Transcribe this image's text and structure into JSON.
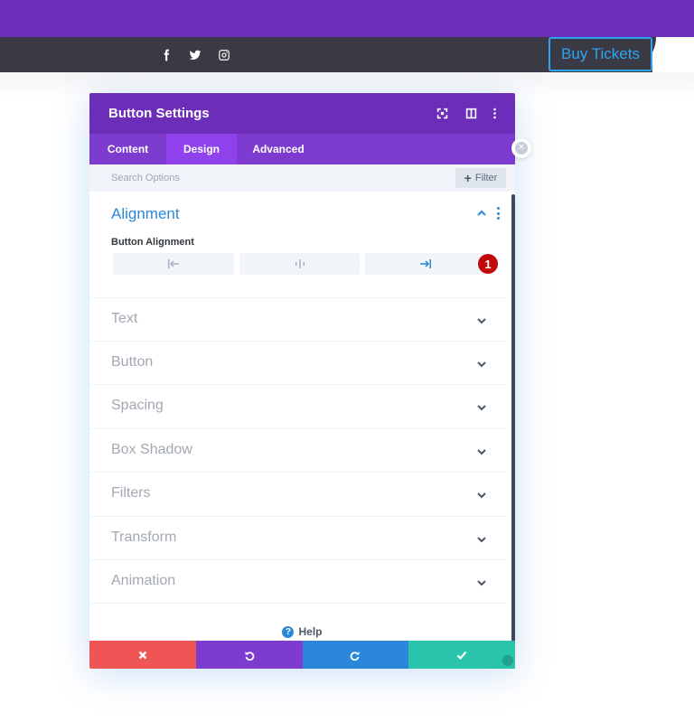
{
  "site": {
    "social_icons": [
      "facebook-icon",
      "twitter-icon",
      "instagram-icon"
    ],
    "buy_button": "Buy Tickets",
    "colors": {
      "topbar": "#6c2eb9",
      "darkbar": "#3a3a44",
      "accent": "#2ea3f2"
    }
  },
  "modal": {
    "title": "Button Settings",
    "header_icons": [
      "expand-icon",
      "split-view-icon",
      "more-options-icon"
    ],
    "tabs": [
      {
        "label": "Content",
        "active": false
      },
      {
        "label": "Design",
        "active": true
      },
      {
        "label": "Advanced",
        "active": false
      }
    ],
    "search": {
      "placeholder": "Search Options",
      "filter_label": "Filter"
    },
    "alignment": {
      "title": "Alignment",
      "field_label": "Button Alignment",
      "options": [
        "align-left-icon",
        "align-center-icon",
        "align-right-icon"
      ],
      "selected": "right",
      "badge": "1"
    },
    "sections": [
      "Text",
      "Button",
      "Spacing",
      "Box Shadow",
      "Filters",
      "Transform",
      "Animation"
    ],
    "help_label": "Help",
    "footer_actions": [
      {
        "name": "discard",
        "color": "#ef5555"
      },
      {
        "name": "undo",
        "color": "#7e3bd0"
      },
      {
        "name": "redo",
        "color": "#2b87da"
      },
      {
        "name": "save",
        "color": "#29c4a9"
      }
    ]
  }
}
